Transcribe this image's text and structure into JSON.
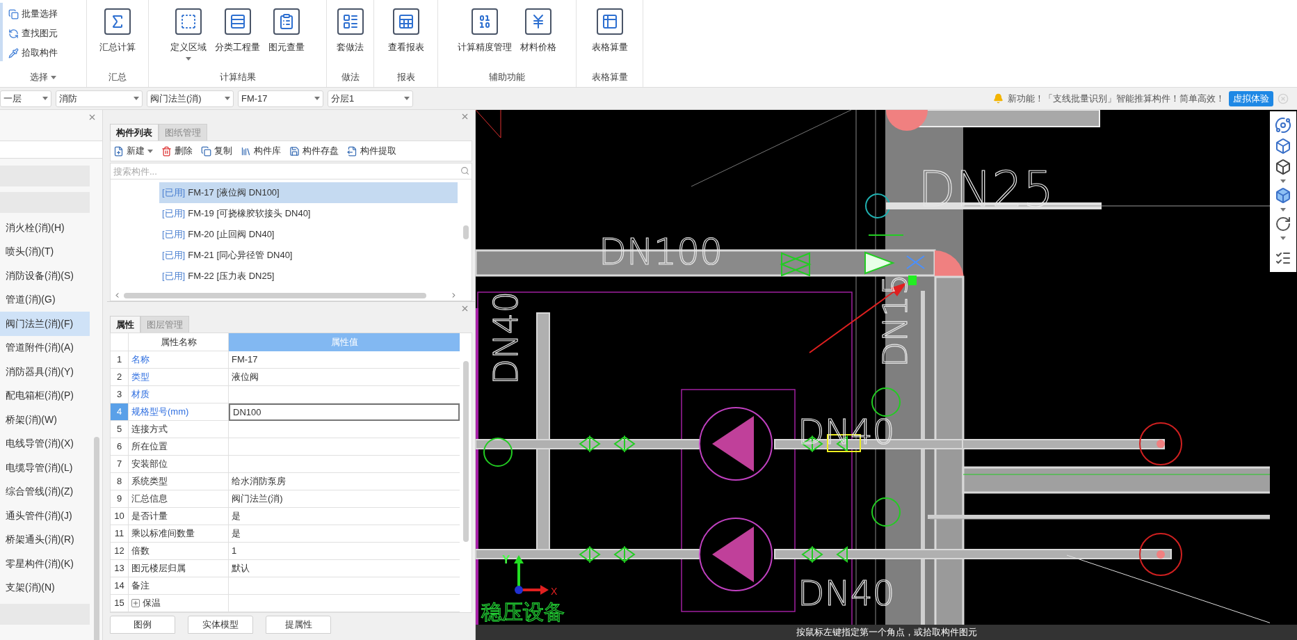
{
  "ribbon": {
    "groups": [
      {
        "label": "选择",
        "label_dropdown": true,
        "kind": "small",
        "items": [
          {
            "label": "批量选择",
            "dropdown": false
          },
          {
            "label": "查找图元",
            "dropdown": false
          },
          {
            "label": "拾取构件",
            "dropdown": false
          }
        ]
      },
      {
        "label": "汇总",
        "label_dropdown": false,
        "kind": "large",
        "items": [
          {
            "label": "汇总计算",
            "dropdown": false
          }
        ]
      },
      {
        "label": "计算结果",
        "label_dropdown": false,
        "kind": "large",
        "items": [
          {
            "label": "定义区域",
            "dropdown": true
          },
          {
            "label": "分类工程量",
            "dropdown": false
          },
          {
            "label": "图元查量",
            "dropdown": false
          }
        ]
      },
      {
        "label": "做法",
        "label_dropdown": false,
        "kind": "large",
        "items": [
          {
            "label": "套做法",
            "dropdown": false
          }
        ]
      },
      {
        "label": "报表",
        "label_dropdown": false,
        "kind": "large",
        "items": [
          {
            "label": "查看报表",
            "dropdown": false
          }
        ]
      },
      {
        "label": "辅助功能",
        "label_dropdown": false,
        "kind": "large",
        "items": [
          {
            "label": "计算精度管理",
            "dropdown": false
          },
          {
            "label": "材料价格",
            "dropdown": false
          }
        ]
      },
      {
        "label": "表格算量",
        "label_dropdown": false,
        "kind": "large",
        "items": [
          {
            "label": "表格算量",
            "dropdown": false
          }
        ]
      }
    ]
  },
  "filters": [
    {
      "value": "一层"
    },
    {
      "value": "消防"
    },
    {
      "value": "阀门法兰(消)"
    },
    {
      "value": "FM-17"
    },
    {
      "value": "分层1"
    }
  ],
  "notice": {
    "text": "新功能！「支线批量识别」智能推算构件！简单高效！",
    "button": "虚拟体验"
  },
  "sidebar": {
    "items": [
      {
        "label": "消火栓(消)(H)",
        "selected": false
      },
      {
        "label": "喷头(消)(T)",
        "selected": false
      },
      {
        "label": "消防设备(消)(S)",
        "selected": false
      },
      {
        "label": "管道(消)(G)",
        "selected": false
      },
      {
        "label": "阀门法兰(消)(F)",
        "selected": true
      },
      {
        "label": "管道附件(消)(A)",
        "selected": false
      },
      {
        "label": "消防器具(消)(Y)",
        "selected": false
      },
      {
        "label": "配电箱柜(消)(P)",
        "selected": false
      },
      {
        "label": "桥架(消)(W)",
        "selected": false
      },
      {
        "label": "电线导管(消)(X)",
        "selected": false
      },
      {
        "label": "电缆导管(消)(L)",
        "selected": false
      },
      {
        "label": "综合管线(消)(Z)",
        "selected": false
      },
      {
        "label": "通头管件(消)(J)",
        "selected": false
      },
      {
        "label": "桥架通头(消)(R)",
        "selected": false
      },
      {
        "label": "零星构件(消)(K)",
        "selected": false
      },
      {
        "label": "支架(消)(N)",
        "selected": false
      }
    ]
  },
  "component_panel": {
    "tabs": [
      {
        "label": "构件列表",
        "selected": true
      },
      {
        "label": "图纸管理",
        "selected": false
      }
    ],
    "toolbar": [
      {
        "label": "新建",
        "dropdown": true
      },
      {
        "label": "删除",
        "dropdown": false
      },
      {
        "label": "复制",
        "dropdown": false
      },
      {
        "label": "构件库",
        "dropdown": false
      },
      {
        "label": "构件存盘",
        "dropdown": false
      },
      {
        "label": "构件提取",
        "dropdown": false
      }
    ],
    "search": {
      "placeholder": "搜索构件..."
    },
    "items": [
      {
        "tag": "[已用]",
        "text": "FM-17 [液位阀 DN100]",
        "selected": true
      },
      {
        "tag": "[已用]",
        "text": "FM-19 [可挠橡胶软接头 DN40]",
        "selected": false
      },
      {
        "tag": "[已用]",
        "text": "FM-20 [止回阀 DN40]",
        "selected": false
      },
      {
        "tag": "[已用]",
        "text": "FM-21 [同心异径管 DN40]",
        "selected": false
      },
      {
        "tag": "[已用]",
        "text": "FM-22 [压力表 DN25]",
        "selected": false
      }
    ]
  },
  "properties_panel": {
    "tabs": [
      {
        "label": "属性",
        "selected": true
      },
      {
        "label": "图层管理",
        "selected": false
      }
    ],
    "columns": [
      "属性名称",
      "属性值"
    ],
    "rows": [
      {
        "index": "1",
        "name": "名称",
        "value": "FM-17",
        "linked": true,
        "selected": false,
        "expandable": false
      },
      {
        "index": "2",
        "name": "类型",
        "value": "液位阀",
        "linked": true,
        "selected": false,
        "expandable": false
      },
      {
        "index": "3",
        "name": "材质",
        "value": "",
        "linked": true,
        "selected": false,
        "expandable": false
      },
      {
        "index": "4",
        "name": "规格型号(mm)",
        "value": "DN100",
        "linked": true,
        "selected": true,
        "expandable": false
      },
      {
        "index": "5",
        "name": "连接方式",
        "value": "",
        "linked": false,
        "selected": false,
        "expandable": false
      },
      {
        "index": "6",
        "name": "所在位置",
        "value": "",
        "linked": false,
        "selected": false,
        "expandable": false
      },
      {
        "index": "7",
        "name": "安装部位",
        "value": "",
        "linked": false,
        "selected": false,
        "expandable": false
      },
      {
        "index": "8",
        "name": "系统类型",
        "value": "给水消防泵房",
        "linked": false,
        "selected": false,
        "expandable": false
      },
      {
        "index": "9",
        "name": "汇总信息",
        "value": "阀门法兰(消)",
        "linked": false,
        "selected": false,
        "expandable": false
      },
      {
        "index": "10",
        "name": "是否计量",
        "value": "是",
        "linked": false,
        "selected": false,
        "expandable": false
      },
      {
        "index": "11",
        "name": "乘以标准间数量",
        "value": "是",
        "linked": false,
        "selected": false,
        "expandable": false
      },
      {
        "index": "12",
        "name": "倍数",
        "value": "1",
        "linked": false,
        "selected": false,
        "expandable": false
      },
      {
        "index": "13",
        "name": "图元楼层归属",
        "value": "默认",
        "linked": false,
        "selected": false,
        "expandable": false
      },
      {
        "index": "14",
        "name": "备注",
        "value": "",
        "linked": false,
        "selected": false,
        "expandable": false
      },
      {
        "index": "15",
        "name": "保温",
        "value": "",
        "linked": false,
        "selected": false,
        "expandable": true
      }
    ],
    "buttons": [
      "图例",
      "实体模型",
      "提属性"
    ]
  },
  "canvas": {
    "labels": [
      {
        "text": "DN100"
      },
      {
        "text": "DN25"
      },
      {
        "text": "DN15"
      },
      {
        "text": "DN40"
      },
      {
        "text": "DN40"
      },
      {
        "text": "DN40"
      },
      {
        "text": "稳压设备"
      }
    ],
    "axis": {
      "x": "X",
      "y": "Y"
    },
    "status": "按鼠标左键指定第一个角点，或拾取构件图元"
  }
}
